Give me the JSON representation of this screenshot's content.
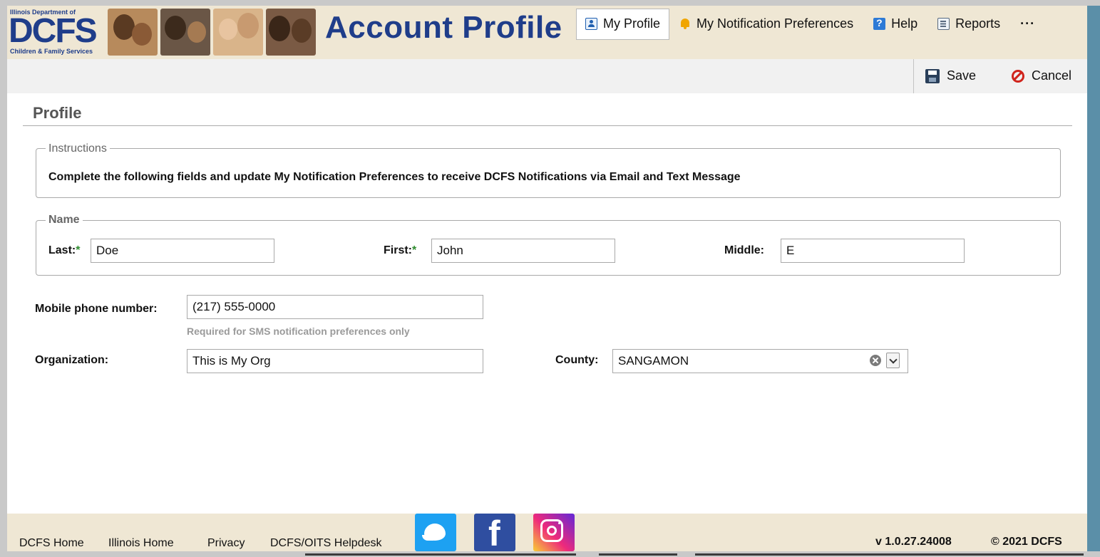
{
  "header": {
    "logo": {
      "dept": "Illinois Department of",
      "big": "DCFS",
      "sub": "Children & Family Services"
    },
    "title": "Account Profile",
    "nav": [
      {
        "label": "My Profile",
        "icon": "profile-icon",
        "active": true
      },
      {
        "label": "My Notification Preferences",
        "icon": "bell-icon"
      },
      {
        "label": "Help",
        "icon": "help-icon"
      },
      {
        "label": "Reports",
        "icon": "reports-icon"
      },
      {
        "label": "···",
        "icon": "more-icon"
      }
    ]
  },
  "toolbar": {
    "save_label": "Save",
    "cancel_label": "Cancel"
  },
  "profile": {
    "section_title": "Profile",
    "instructions": {
      "legend": "Instructions",
      "text": "Complete the following fields and update My Notification Preferences to receive DCFS Notifications via Email and Text Message"
    },
    "name": {
      "legend": "Name",
      "last_label": "Last:",
      "last_value": "Doe",
      "first_label": "First:",
      "first_value": "John",
      "middle_label": "Middle:",
      "middle_value": "E",
      "required_marker": "*"
    },
    "mobile": {
      "label": "Mobile phone number:",
      "value": "(217) 555-0000",
      "hint": "Required for SMS notification preferences only"
    },
    "organization": {
      "label": "Organization:",
      "value": "This is My Org"
    },
    "county": {
      "label": "County:",
      "value": "SANGAMON"
    }
  },
  "footer": {
    "links": [
      "DCFS Home",
      "Illinois Home",
      "Privacy",
      "DCFS/OITS Helpdesk"
    ],
    "social": [
      "twitter-icon",
      "facebook-icon",
      "instagram-icon"
    ],
    "version": "v 1.0.27.24008",
    "copyright": "© 2021 DCFS"
  },
  "colors": {
    "brand_blue": "#1f3d8a",
    "header_bg": "#efe7d4",
    "required_green": "#2e8b2e",
    "cancel_red": "#d0241c"
  }
}
